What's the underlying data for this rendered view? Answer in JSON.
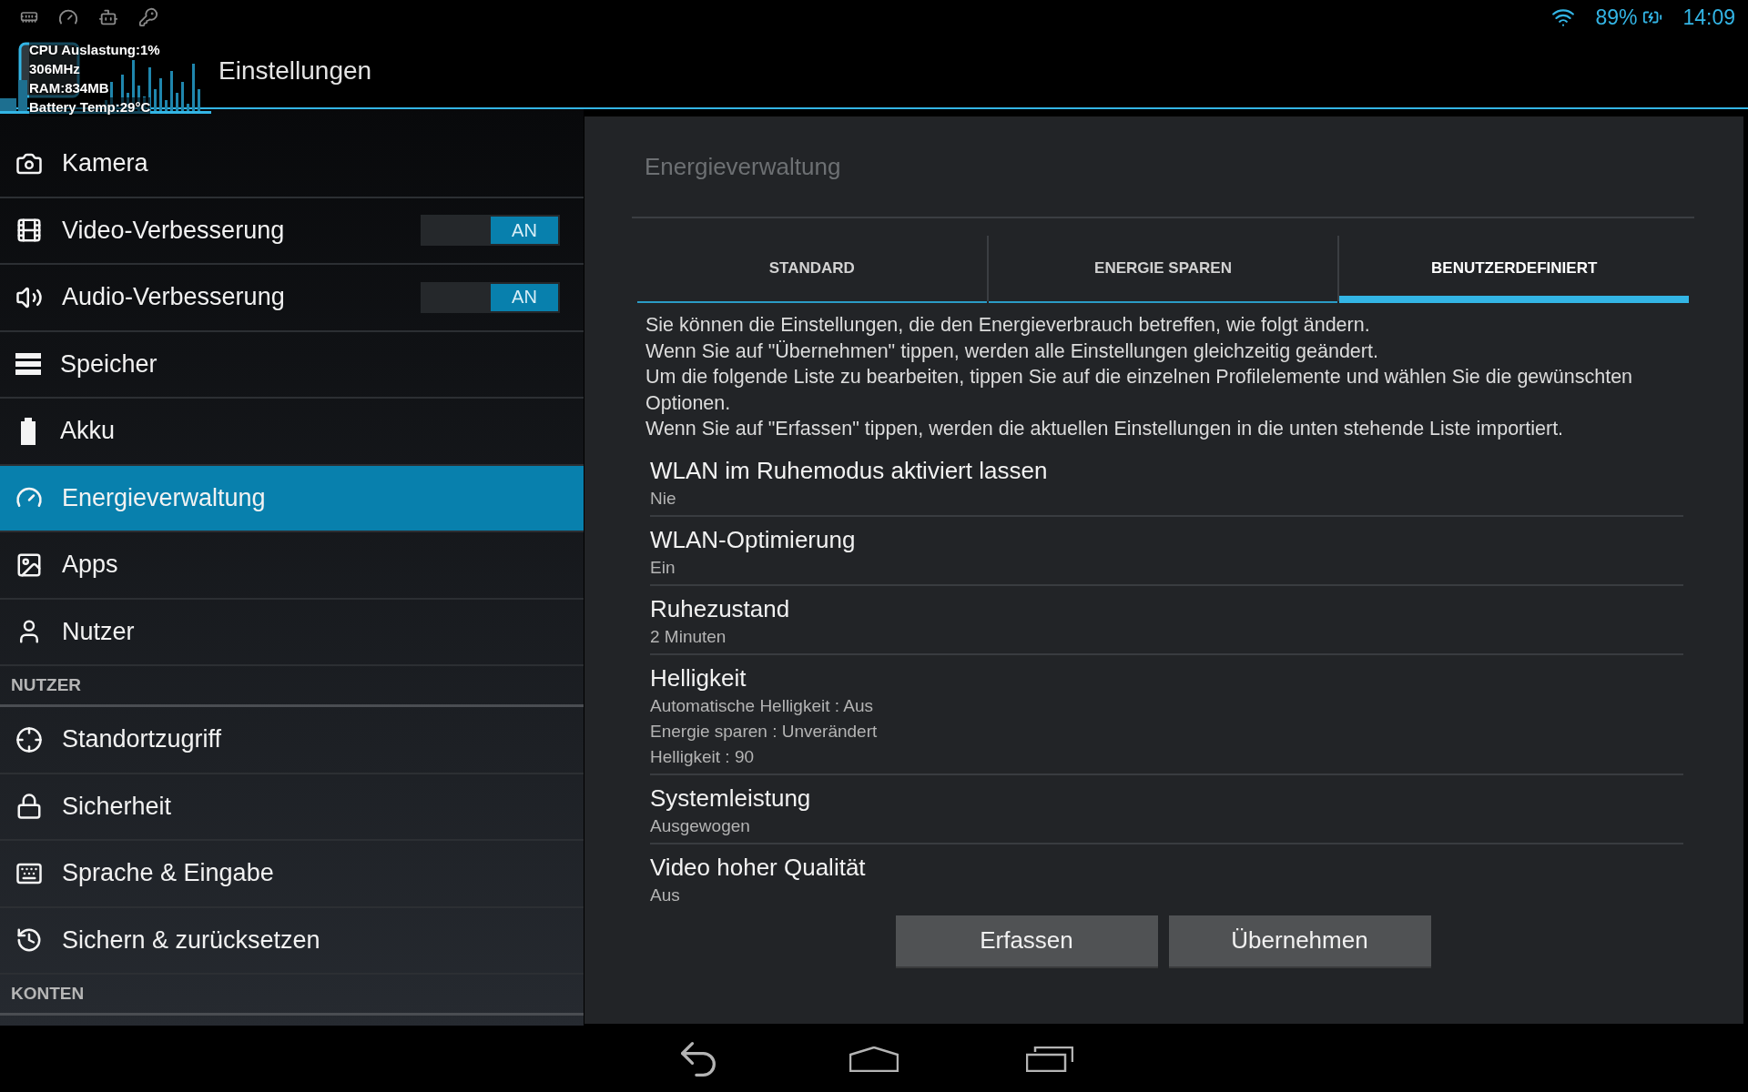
{
  "status_bar": {
    "battery": "89%",
    "time": "14:09"
  },
  "monitor_overlay": {
    "lines": [
      "CPU Auslastung:1%",
      "306MHz",
      "RAM:834MB",
      "Battery Temp:29°C"
    ]
  },
  "action_bar": {
    "title": "Einstellungen"
  },
  "sidebar": {
    "items": [
      {
        "kind": "item",
        "label": "Kamera",
        "selected": false
      },
      {
        "kind": "toggle",
        "label": "Video-Verbesserung",
        "selected": false,
        "toggle": {
          "label": "AN",
          "on": true
        }
      },
      {
        "kind": "toggle",
        "label": "Audio-Verbesserung",
        "selected": false,
        "toggle": {
          "label": "AN",
          "on": true
        }
      },
      {
        "kind": "item",
        "label": "Speicher",
        "selected": false
      },
      {
        "kind": "item",
        "label": "Akku",
        "selected": false
      },
      {
        "kind": "item",
        "label": "Energieverwaltung",
        "selected": true
      },
      {
        "kind": "item",
        "label": "Apps",
        "selected": false
      },
      {
        "kind": "item",
        "label": "Nutzer",
        "selected": false
      },
      {
        "kind": "header",
        "label": "NUTZER"
      },
      {
        "kind": "item",
        "label": "Standortzugriff",
        "selected": false
      },
      {
        "kind": "item",
        "label": "Sicherheit",
        "selected": false
      },
      {
        "kind": "item",
        "label": "Sprache & Eingabe",
        "selected": false
      },
      {
        "kind": "item",
        "label": "Sichern & zurücksetzen",
        "selected": false
      },
      {
        "kind": "header",
        "label": "KONTEN"
      }
    ]
  },
  "panel": {
    "title": "Energieverwaltung",
    "tabs": [
      {
        "label": "STANDARD",
        "selected": false
      },
      {
        "label": "ENERGIE SPAREN",
        "selected": false
      },
      {
        "label": "BENUTZERDEFINIERT",
        "selected": true
      }
    ],
    "description": [
      "Sie können die Einstellungen, die den Energieverbrauch betreffen, wie folgt ändern.",
      "Wenn Sie auf \"Übernehmen\" tippen, werden alle Einstellungen gleichzeitig geändert.",
      "Um die folgende Liste zu bearbeiten, tippen Sie auf die einzelnen Profilelemente und wählen Sie die gewünschten Optionen.",
      "Wenn Sie auf \"Erfassen\" tippen, werden die aktuellen Einstellungen in die unten stehende Liste importiert."
    ],
    "settings": [
      {
        "title": "WLAN im Ruhemodus aktiviert lassen",
        "values": [
          "Nie"
        ]
      },
      {
        "title": "WLAN-Optimierung",
        "values": [
          "Ein"
        ]
      },
      {
        "title": "Ruhezustand",
        "values": [
          "2 Minuten"
        ]
      },
      {
        "title": "Helligkeit",
        "values": [
          "Automatische Helligkeit : Aus",
          "Energie sparen : Unverändert",
          "Helligkeit : 90"
        ]
      },
      {
        "title": "Systemleistung",
        "values": [
          "Ausgewogen"
        ]
      },
      {
        "title": "Video hoher Qualität",
        "values": [
          "Aus"
        ]
      }
    ],
    "buttons": [
      "Erfassen",
      "Übernehmen"
    ]
  }
}
